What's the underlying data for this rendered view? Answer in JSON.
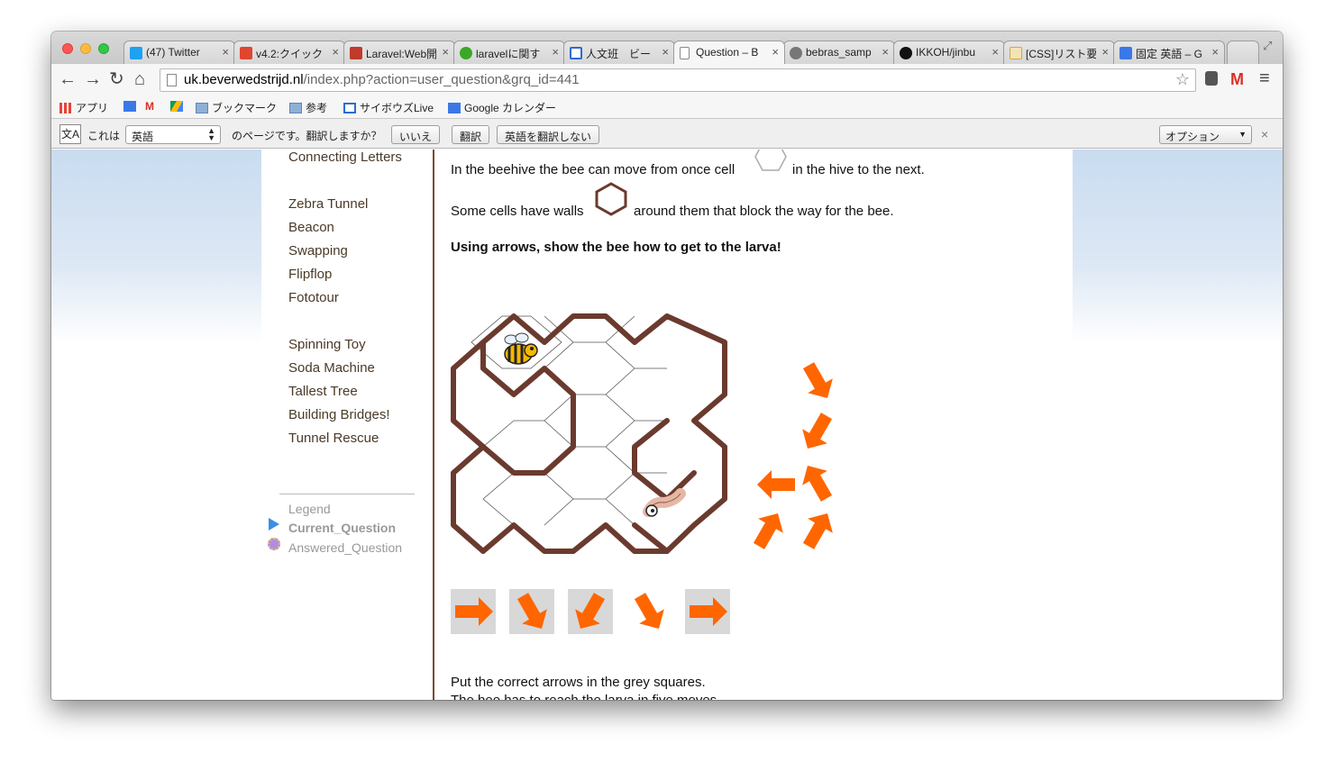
{
  "tabs": [
    {
      "label": "(47) Twitter",
      "icon": "twitter-icon",
      "color": "#1da1f2"
    },
    {
      "label": "v4.2:クイック",
      "icon": "laravel-icon",
      "color": "#e0452f"
    },
    {
      "label": "Laravel:Web開",
      "icon": "book-icon",
      "color": "#c0392b"
    },
    {
      "label": "laravelに関す",
      "icon": "bulb-icon",
      "color": "#3aa826"
    },
    {
      "label": "人文班　ビー",
      "icon": "window-icon",
      "color": "#2c6bd1"
    },
    {
      "label": "Question – B",
      "icon": "page-icon",
      "color": "#888888"
    },
    {
      "label": "bebras_samp",
      "icon": "globe-icon",
      "color": "#555555"
    },
    {
      "label": "IKKOH/jinbu",
      "icon": "github-icon",
      "color": "#111111"
    },
    {
      "label": "[CSS]リスト要",
      "icon": "blog-icon",
      "color": "#d9a441"
    },
    {
      "label": "固定 英語 – G",
      "icon": "google-icon",
      "color": "#3b78e7"
    }
  ],
  "address": {
    "host": "uk.beverwedstrijd.nl",
    "path": "/index.php?action=user_question&grq_id=441"
  },
  "bookmarks": [
    {
      "label": "アプリ",
      "icon": "apps-icon"
    },
    {
      "label": "ブックマーク",
      "icon": "folder-icon"
    },
    {
      "label": "参考",
      "icon": "folder-icon"
    },
    {
      "label": "サイボウズLive",
      "icon": "cybozu-icon"
    },
    {
      "label": "Google カレンダー",
      "icon": "calendar-icon"
    }
  ],
  "translate": {
    "prefix": "これは",
    "language": "英語",
    "suffix": "のページです。翻訳しますか？",
    "no": "いいえ",
    "translate": "翻訳",
    "never": "英語を翻訳しない",
    "options": "オプション"
  },
  "sidebar": {
    "links_top": [
      "Connecting Letters"
    ],
    "links_group1": [
      "Zebra Tunnel",
      "Beacon",
      "Swapping",
      "Flipflop",
      "Fototour"
    ],
    "links_group2": [
      "Spinning Toy",
      "Soda Machine",
      "Tallest Tree",
      "Building Bridges!",
      "Tunnel Rescue"
    ],
    "legend_title": "Legend",
    "legend_current": "Current_Question",
    "legend_answered": "Answered_Question"
  },
  "question": {
    "line1a": "In the beehive the bee can move from once cell",
    "line1b": "in the hive to the next.",
    "line2a": "Some cells have walls",
    "line2b": "around them that block the way for the bee.",
    "instruction": "Using arrows, show the bee how to get to the larva!",
    "footer1": "Put the correct arrows in the grey squares.",
    "footer2": "The bee has to reach the larva in five moves."
  },
  "colors": {
    "wall": "#6b3a2e",
    "arrow": "#ff6600",
    "slot": "#d8d8d8",
    "accent": "#7b4a2a"
  }
}
